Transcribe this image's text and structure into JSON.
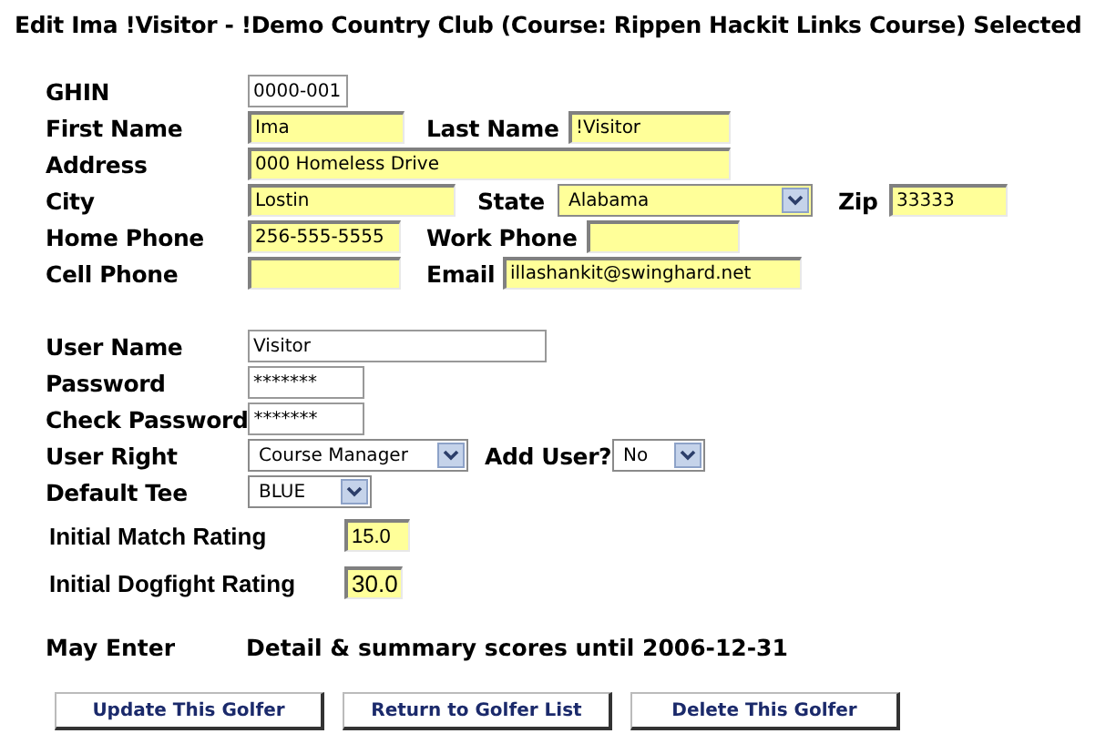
{
  "title": "Edit Ima !Visitor - !Demo Country Club (Course: Rippen Hackit Links Course) Selected",
  "sections": [
    {
      "rows": [
        [
          {
            "label": "GHIN",
            "field": {
              "kind": "text",
              "value": "0000-001",
              "highlighted": false
            }
          }
        ],
        [
          {
            "label": "First Name",
            "field": {
              "kind": "text",
              "value": "Ima",
              "highlighted": true
            }
          },
          {
            "label": "Last Name",
            "field": {
              "kind": "text",
              "value": "!Visitor",
              "highlighted": true
            }
          }
        ],
        [
          {
            "label": "Address",
            "field": {
              "kind": "text",
              "value": "000 Homeless Drive",
              "highlighted": true
            }
          }
        ],
        [
          {
            "label": "City",
            "field": {
              "kind": "text",
              "value": "Lostin",
              "highlighted": true
            }
          },
          {
            "label": "State",
            "field": {
              "kind": "select",
              "value": "Alabama",
              "highlighted": true
            }
          },
          {
            "label": "Zip",
            "field": {
              "kind": "text",
              "value": "33333",
              "highlighted": true
            }
          }
        ],
        [
          {
            "label": "Home Phone",
            "field": {
              "kind": "text",
              "value": "256-555-5555",
              "highlighted": true
            }
          },
          {
            "label": "Work Phone",
            "field": {
              "kind": "text",
              "highlighted": true
            }
          }
        ],
        [
          {
            "label": "Cell Phone",
            "field": {
              "kind": "text",
              "highlighted": true
            }
          },
          {
            "label": "Email",
            "field": {
              "kind": "text",
              "value": "illashankit@swinghard.net",
              "highlighted": true
            }
          }
        ]
      ]
    },
    {
      "rows": [
        [
          {
            "label": "User Name",
            "field": {
              "kind": "text",
              "value": "Visitor",
              "highlighted": false
            }
          }
        ],
        [
          {
            "label": "Password",
            "field": {
              "kind": "text",
              "value": "*******",
              "highlighted": false
            }
          }
        ],
        [
          {
            "label": "Check Password",
            "field": {
              "kind": "text",
              "value": "*******",
              "highlighted": false
            }
          }
        ],
        [
          {
            "label": "User Right",
            "field": {
              "kind": "select",
              "value": "Course Manager",
              "highlighted": false
            }
          },
          {
            "label": "Add User?",
            "field": {
              "kind": "select",
              "value": "No",
              "highlighted": false
            }
          }
        ],
        [
          {
            "label": "Default Tee",
            "field": {
              "kind": "select",
              "value": "BLUE",
              "highlighted": false
            }
          }
        ]
      ]
    }
  ],
  "ratings": [
    {
      "label": "Initial Match Rating",
      "value": "15.0",
      "highlighted": true
    },
    {
      "label": "Initial Dogfight Rating",
      "value": "30.0",
      "highlighted": true
    }
  ],
  "may_enter": {
    "label": "May Enter",
    "value": "Detail & summary scores until 2006-12-31"
  },
  "buttons": [
    "Update This Golfer",
    "Return to Golfer List",
    "Delete This Golfer"
  ]
}
